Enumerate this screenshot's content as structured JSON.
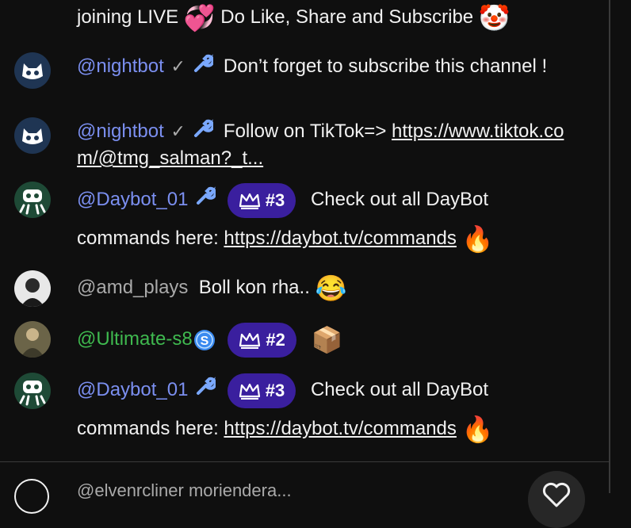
{
  "messages": [
    {
      "text_line": "joining LIVE",
      "text_after": "Do Like, Share and Subscribe",
      "emoji_1": "💞",
      "emoji_2": "🤡"
    },
    {
      "handle": "@nightbot",
      "text": "Don’t forget to subscribe this channel !"
    },
    {
      "handle": "@nightbot",
      "text": "Follow on TikTok=> ",
      "link": "https://www.tiktok.com/@tmg_salman?_t..."
    },
    {
      "handle": "@Daybot_01",
      "badge": "#3",
      "text": "Check out all DayBot commands here: ",
      "link": "https://daybot.tv/commands",
      "emoji": "🔥"
    },
    {
      "handle": "@amd_plays",
      "text": "Boll kon rha..",
      "emoji": "😂"
    },
    {
      "handle": "@Ultimate-s8",
      "badge": "#2",
      "emoji": "📦"
    },
    {
      "handle": "@Daybot_01",
      "badge": "#3",
      "text": "Check out all DayBot commands here: ",
      "link": "https://daybot.tv/commands",
      "emoji": "🔥"
    }
  ],
  "composer": {
    "placeholder": "@elvenrcliner moriendera..."
  },
  "colors": {
    "background": "#0f0f0f",
    "mod_handle": "#7b8ff0",
    "member_handle": "#3fb94f",
    "viewer_handle": "#aaaaaa",
    "badge_bg": "#3a1f9e"
  },
  "icons": {
    "verified": "check-icon",
    "moderator": "wrench-icon",
    "crown": "crown-icon",
    "sponsor": "s-coin-icon",
    "like": "heart-icon"
  }
}
